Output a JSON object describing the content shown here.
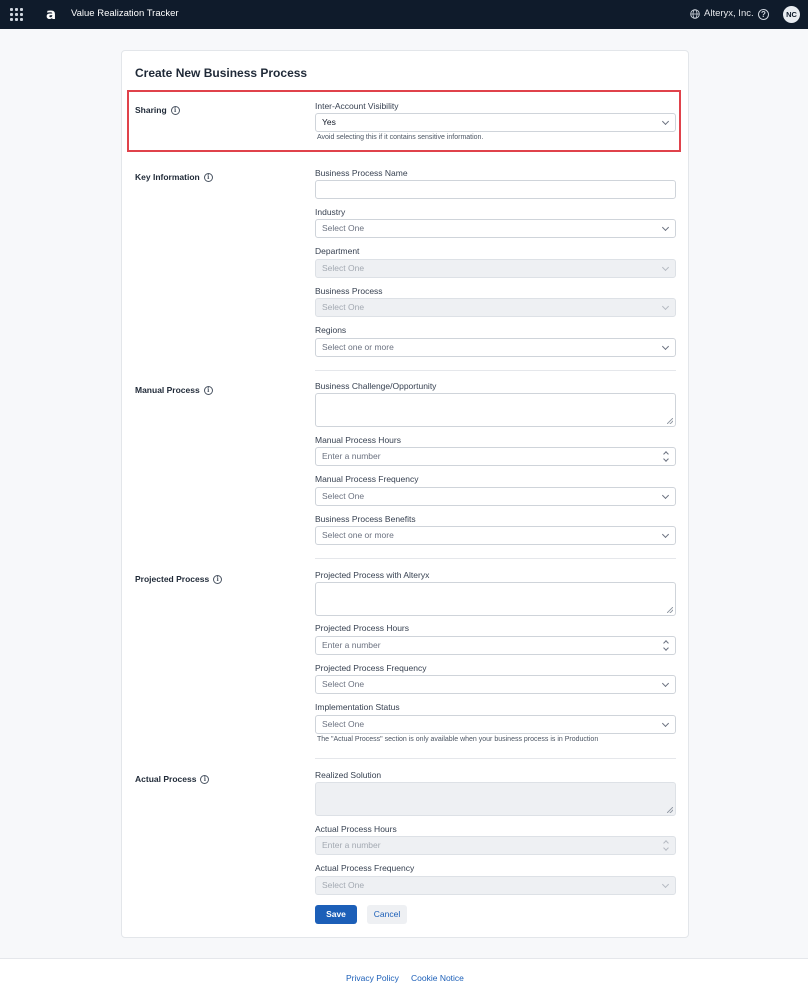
{
  "header": {
    "logo": "a",
    "app_title": "Value Realization Tracker",
    "org_name": "Alteryx, Inc.",
    "help": "?",
    "avatar_initials": "NC"
  },
  "form": {
    "title": "Create New Business Process",
    "sections": {
      "sharing": "Sharing",
      "key_information": "Key Information",
      "manual_process": "Manual Process",
      "projected_process": "Projected Process",
      "actual_process": "Actual Process"
    },
    "fields": {
      "inter_account_visibility": {
        "label": "Inter-Account Visibility",
        "value": "Yes",
        "hint": "Avoid selecting this if it contains sensitive information."
      },
      "business_process_name": {
        "label": "Business Process Name",
        "value": ""
      },
      "industry": {
        "label": "Industry",
        "value": "Select One"
      },
      "department": {
        "label": "Department",
        "value": "Select One"
      },
      "business_process": {
        "label": "Business Process",
        "value": "Select One"
      },
      "regions": {
        "label": "Regions",
        "value": "Select one or more"
      },
      "business_challenge": {
        "label": "Business Challenge/Opportunity",
        "value": ""
      },
      "manual_process_hours": {
        "label": "Manual Process Hours",
        "placeholder": "Enter a number"
      },
      "manual_process_frequency": {
        "label": "Manual Process Frequency",
        "value": "Select One"
      },
      "business_process_benefits": {
        "label": "Business Process Benefits",
        "value": "Select one or more"
      },
      "projected_process_with_alteryx": {
        "label": "Projected Process with Alteryx",
        "value": ""
      },
      "projected_process_hours": {
        "label": "Projected Process Hours",
        "placeholder": "Enter a number"
      },
      "projected_process_frequency": {
        "label": "Projected Process Frequency",
        "value": "Select One"
      },
      "implementation_status": {
        "label": "Implementation Status",
        "value": "Select One",
        "hint": "The \"Actual Process\" section is only available when your business process is in Production"
      },
      "realized_solution": {
        "label": "Realized Solution",
        "value": ""
      },
      "actual_process_hours": {
        "label": "Actual Process Hours",
        "placeholder": "Enter a number"
      },
      "actual_process_frequency": {
        "label": "Actual Process Frequency",
        "value": "Select One"
      }
    },
    "buttons": {
      "save": "Save",
      "cancel": "Cancel"
    }
  },
  "footer": {
    "privacy": "Privacy Policy",
    "cookie": "Cookie Notice"
  },
  "colors": {
    "topbar": "#0f1b2b",
    "primary": "#1c5fb8",
    "highlight": "#e0424b"
  }
}
